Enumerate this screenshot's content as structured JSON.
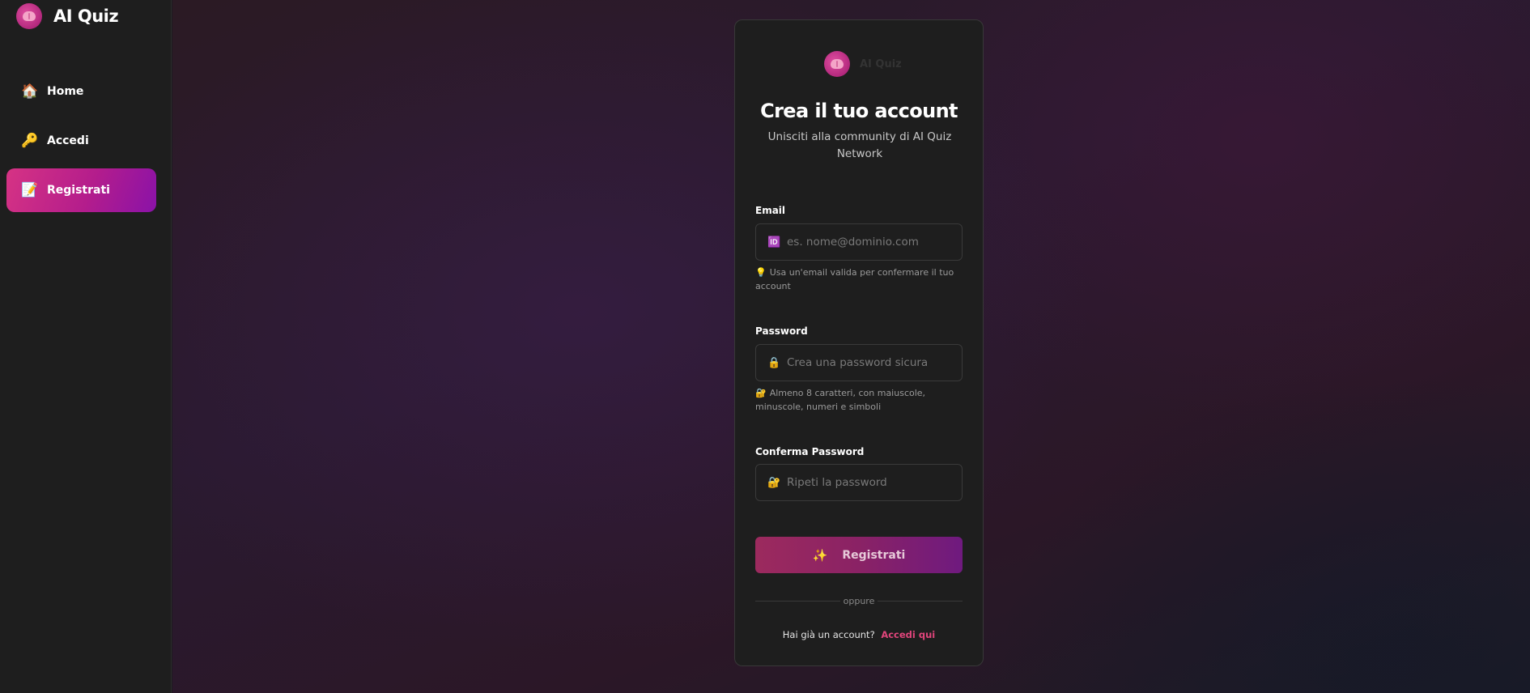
{
  "sidebar": {
    "brand_name": "AI Quiz",
    "items": [
      {
        "label": "Home",
        "icon": "house-icon",
        "active": false
      },
      {
        "label": "Accedi",
        "icon": "key-icon",
        "active": false
      },
      {
        "label": "Registrati",
        "icon": "memo-icon",
        "active": true
      }
    ]
  },
  "card": {
    "brand_name": "AI Quiz",
    "title": "Crea il tuo account",
    "subtitle": "Unisciti alla community di AI Quiz Network",
    "email": {
      "label": "Email",
      "placeholder": "es. nome@dominio.com",
      "value": "",
      "hint": "Usa un'email valida per confermare il tuo account"
    },
    "password": {
      "label": "Password",
      "placeholder": "Crea una password sicura",
      "value": "",
      "hint": "Almeno 8 caratteri, con maiuscole, minuscole, numeri e simboli"
    },
    "confirm_password": {
      "label": "Conferma Password",
      "placeholder": "Ripeti la password",
      "value": ""
    },
    "submit_label": "Registrati",
    "divider_text": "oppure",
    "signin_prompt": "Hai già un account?",
    "signin_link": "Accedi qui"
  },
  "colors": {
    "accent": "#d63384",
    "accent_end": "#8a12a8",
    "link": "#e0457b",
    "card_bg": "#1e1e1e"
  }
}
